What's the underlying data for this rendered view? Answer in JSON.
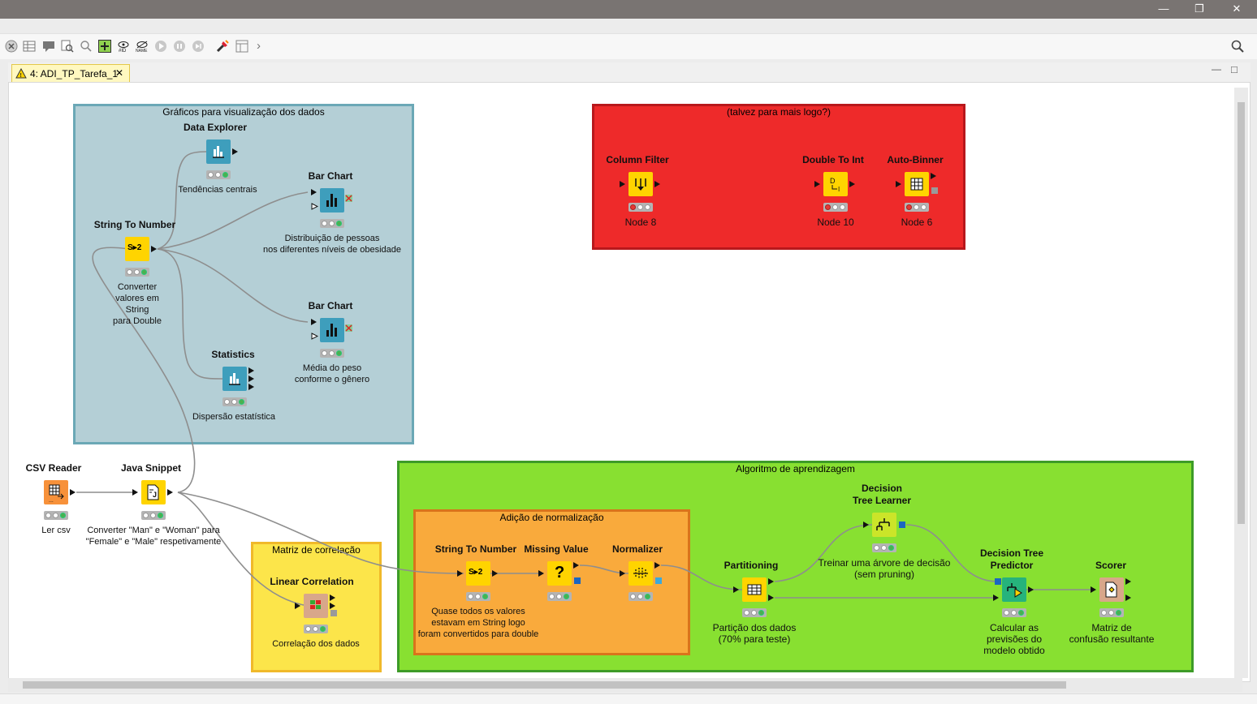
{
  "window": {
    "minimize": "—",
    "restore": "❐",
    "close": "✕"
  },
  "toolbar": {
    "chevron": "›",
    "search_icon": "search-icon"
  },
  "tab": {
    "label": "4: ADI_TP_Tarefa_1",
    "close": "✕"
  },
  "view_controls": {
    "minimize": "—",
    "maximize": "□"
  },
  "annotations": {
    "graficos": "Gráficos para visualização dos dados",
    "talvez": "(talvez para mais logo?)",
    "algoritmo": "Algoritmo de aprendizagem",
    "normalizacao": "Adição de normalização",
    "matriz": "Matriz de correlação"
  },
  "nodes": {
    "data_explorer": {
      "title": "Data Explorer",
      "label": "Tendências centrais"
    },
    "bar_chart_1": {
      "title": "Bar Chart",
      "label": "Distribuição de pessoas\nnos diferentes níveis de obesidade"
    },
    "string_to_number_1": {
      "title": "String To Number",
      "label": "Converter\nvalores em\nString\npara Double",
      "icon_text": "S▸2"
    },
    "bar_chart_2": {
      "title": "Bar Chart",
      "label": "Média do peso\nconforme o gênero"
    },
    "statistics": {
      "title": "Statistics",
      "label": "Dispersão estatística"
    },
    "column_filter": {
      "title": "Column Filter",
      "label": "Node 8"
    },
    "double_to_int": {
      "title": "Double To Int",
      "label": "Node 10"
    },
    "auto_binner": {
      "title": "Auto-Binner",
      "label": "Node 6"
    },
    "csv_reader": {
      "title": "CSV Reader",
      "label": "Ler csv"
    },
    "java_snippet": {
      "title": "Java Snippet",
      "label": "Converter \"Man\" e \"Woman\" para\n\"Female\" e \"Male\" respetivamente"
    },
    "linear_correlation": {
      "title": "Linear Correlation",
      "label": "Correlação dos dados"
    },
    "string_to_number_2": {
      "title": "String To Number",
      "label": "Quase todos os valores\nestavam em String logo\nforam convertidos para double",
      "icon_text": "S▸2"
    },
    "missing_value": {
      "title": "Missing Value",
      "label": "",
      "icon_text": "?"
    },
    "normalizer": {
      "title": "Normalizer",
      "label": ""
    },
    "partitioning": {
      "title": "Partitioning",
      "label": "Partição dos dados\n(70% para teste)"
    },
    "dt_learner": {
      "title": "Decision\nTree Learner",
      "label": "Treinar uma árvore de decisão\n(sem pruning)"
    },
    "dt_predictor": {
      "title": "Decision Tree\nPredictor",
      "label": "Calcular as\nprevisões do\nmodelo obtido"
    },
    "scorer": {
      "title": "Scorer",
      "label": "Matriz de\nconfusão resultante"
    }
  },
  "colors": {
    "titlebar": "#797472",
    "annot_blue": "#b4cfd6",
    "annot_red": "#ee2a2a",
    "annot_green": "#88e031",
    "annot_orange": "#f9aa3c",
    "annot_yellow": "#fce54a",
    "node_visualizer": "#3e9ebc",
    "node_manipulator": "#ffd400",
    "node_source": "#f7913a",
    "node_learner": "#cbe529",
    "node_predictor": "#26b37c",
    "node_other": "#d8a78a"
  }
}
